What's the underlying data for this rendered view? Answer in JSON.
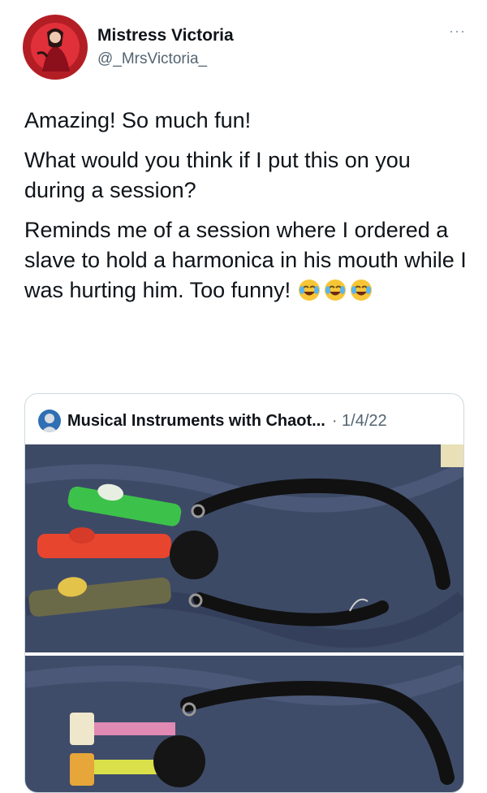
{
  "author": {
    "name": "Mistress Victoria",
    "handle": "@_MrsVictoria_",
    "avatar_icon": "profile-photo"
  },
  "menu": {
    "more_label": "···"
  },
  "tweet": {
    "paragraphs": [
      "Amazing! So much fun!",
      "What would you think if I put this on you during a session?",
      "Reminds me of a session where I ordered a slave to hold a harmonica in his mouth while I was hurting him. Too funny!"
    ],
    "emojis": [
      "face-with-tears-of-joy",
      "face-with-tears-of-joy",
      "face-with-tears-of-joy"
    ]
  },
  "quoted": {
    "name": "Musical Instruments with Chaot...",
    "date": "· 1/4/22",
    "photos": [
      "kazoos-and-ball-gag-photo",
      "party-horns-and-ball-gag-photo"
    ],
    "kazoo_colors": [
      "#3cc24a",
      "#e8452f",
      "#6b6a48"
    ]
  }
}
